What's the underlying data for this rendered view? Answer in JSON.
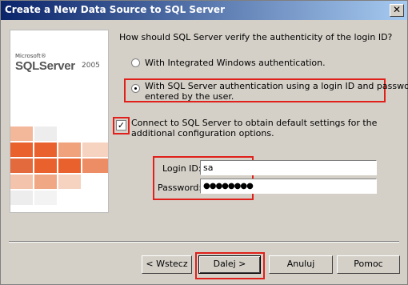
{
  "window": {
    "title": "Create a New Data Source to SQL Server",
    "close_glyph": "✕"
  },
  "banner": {
    "microsoft": "Microsoft®",
    "product": "SQLServer",
    "version": "2005"
  },
  "question": "How should SQL Server verify the authenticity of the login ID?",
  "auth_options": [
    {
      "label": "With Integrated Windows authentication.",
      "selected": false
    },
    {
      "label_line1": "With SQL Server authentication using a login ID and password",
      "label_line2": "entered by the user.",
      "selected": true
    }
  ],
  "connect_checkbox": {
    "line1": "Connect to SQL Server to obtain default settings for the",
    "line2": "additional configuration options.",
    "checked": true,
    "mark": "✓"
  },
  "login": {
    "label": "Login ID:",
    "value": "sa"
  },
  "password": {
    "label": "Password:",
    "value": "●●●●●●●●"
  },
  "buttons": {
    "back": "< Wstecz",
    "next": "Dalej >",
    "cancel": "Anuluj",
    "help": "Pomoc"
  },
  "colors": {
    "highlight": "#e0201b",
    "title_bar": "#0a246a",
    "banner_orange": "#e9622e"
  }
}
